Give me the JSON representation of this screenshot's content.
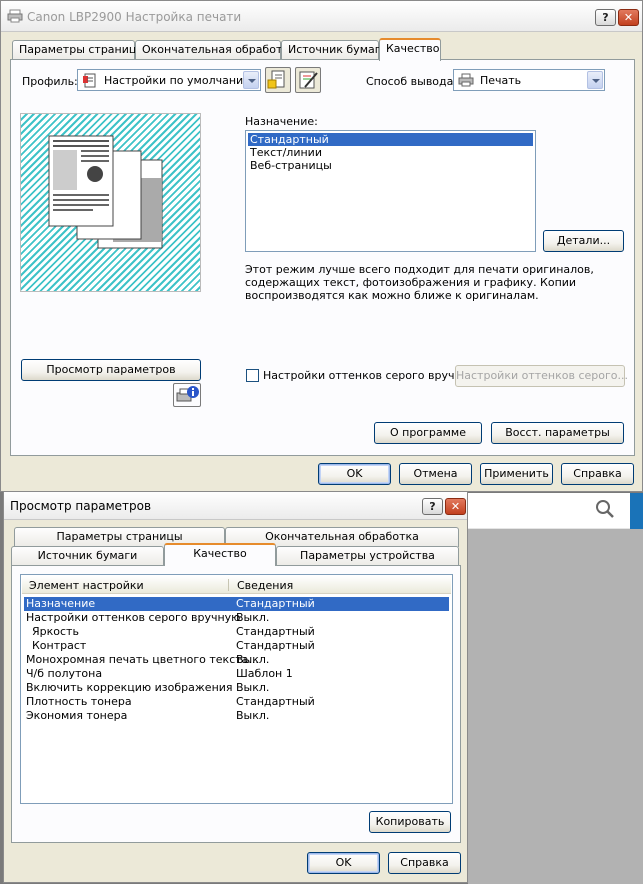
{
  "main": {
    "title": "Canon LBP2900 Настройка печати",
    "help_glyph": "?",
    "close_glyph": "✕",
    "tabs": [
      "Параметры страницы",
      "Окончательная обработка",
      "Источник бумаги",
      "Качество"
    ],
    "profile": {
      "label": "Профиль:",
      "value": "Настройки по умолчанию"
    },
    "output": {
      "label": "Способ вывода:",
      "value": "Печать"
    },
    "purpose": {
      "label": "Назначение:",
      "items": [
        "Стандартный",
        "Текст/линии",
        "Веб-страницы"
      ],
      "selected": 0
    },
    "details_button": "Детали...",
    "description": "Этот режим лучше всего подходит для печати оригиналов, содержащих текст, фотоизображения и графику. Копии воспроизводятся как можно ближе к оригиналам.",
    "view_settings_button": "Просмотр параметров",
    "grayscale_checkbox_label": "Настройки оттенков серого вручную",
    "grayscale_button": "Настройки оттенков серого...",
    "about_button": "О программе",
    "restore_button": "Восст. параметры",
    "ok_button": "OK",
    "cancel_button": "Отмена",
    "apply_button": "Применить",
    "help_button": "Справка"
  },
  "preview": {
    "title": "Просмотр параметров",
    "help_glyph": "?",
    "close_glyph": "✕",
    "tabs_back": [
      "Параметры страницы",
      "Окончательная обработка"
    ],
    "tabs_front": [
      "Источник бумаги",
      "Качество",
      "Параметры устройства"
    ],
    "columns": [
      "Элемент настройки",
      "Сведения"
    ],
    "rows": [
      [
        "Назначение",
        "Стандартный"
      ],
      [
        "Настройки оттенков серого вручную",
        "Выкл."
      ],
      [
        "Яркость",
        "Стандартный"
      ],
      [
        "Контраст",
        "Стандартный"
      ],
      [
        "Монохромная печать цветного текста...",
        "Выкл."
      ],
      [
        "Ч/б полутона",
        "Шаблон 1"
      ],
      [
        "Включить коррекцию изображения",
        "Выкл."
      ],
      [
        "Плотность тонера",
        "Стандартный"
      ],
      [
        "Экономия тонера",
        "Выкл."
      ]
    ],
    "copy_button": "Копировать",
    "ok_button": "OK",
    "help_button": "Справка"
  },
  "search": {
    "icon": "search-icon"
  },
  "colors": {
    "selection": "#316ac5",
    "tab_accent": "#e68b2c",
    "hatch": "#3fc3c8"
  }
}
